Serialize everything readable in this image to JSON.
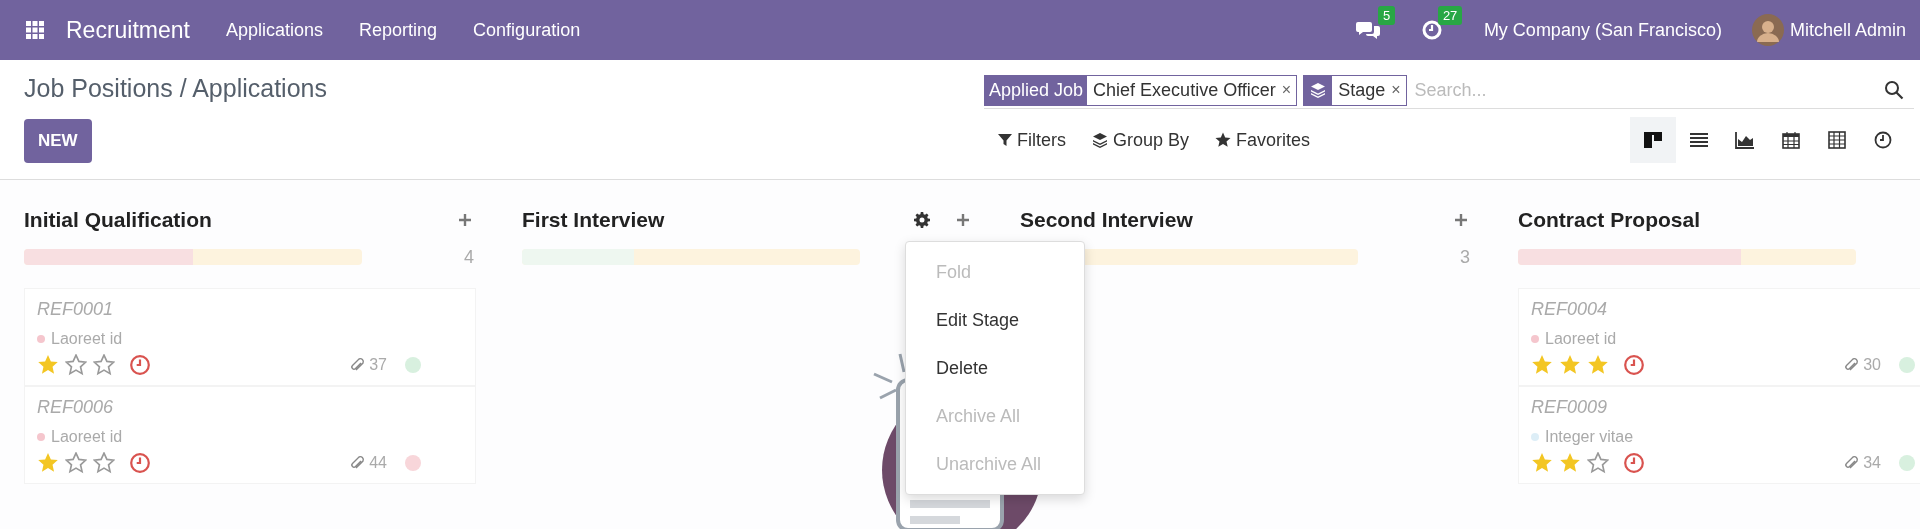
{
  "navbar": {
    "app_name": "Recruitment",
    "menu": [
      "Applications",
      "Reporting",
      "Configuration"
    ],
    "messages_count": "5",
    "activities_count": "27",
    "company": "My Company (San Francisco)",
    "user": "Mitchell Admin"
  },
  "breadcrumb": "Job Positions / Applications",
  "new_button": "NEW",
  "search": {
    "facets": [
      {
        "kind": "filter",
        "label": "Applied Job",
        "value": "Chief Executive Officer",
        "remove": "×"
      },
      {
        "kind": "group_by",
        "value": "Stage",
        "remove": "×"
      }
    ],
    "placeholder": "Search..."
  },
  "search_options": [
    {
      "kind": "filter",
      "label": "Filters"
    },
    {
      "kind": "group_by",
      "label": "Group By"
    },
    {
      "kind": "favorite",
      "label": "Favorites"
    }
  ],
  "views": [
    {
      "kind": "kanban",
      "selected": true
    },
    {
      "kind": "list",
      "selected": false
    },
    {
      "kind": "graph",
      "selected": false
    },
    {
      "kind": "calendar",
      "selected": false
    },
    {
      "kind": "pivot",
      "selected": false
    },
    {
      "kind": "activity",
      "selected": false
    }
  ],
  "columns": [
    {
      "title": "Initial Qualification",
      "quick_create": true,
      "count": "4",
      "progress": {
        "level": 0.5,
        "color": "#f8dfe1"
      },
      "cards": [
        {
          "ref": "REF0001",
          "tag": {
            "label": "Laoreet id",
            "color": "#f5c6cd"
          },
          "stars": 1,
          "attachments": "37",
          "status": {
            "color": "#d8f0df"
          }
        },
        {
          "ref": "REF0006",
          "tag": {
            "label": "Laoreet id",
            "color": "#f5c6cd"
          },
          "stars": 1,
          "attachments": "44",
          "status": {
            "color": "#f8d6da"
          }
        }
      ]
    },
    {
      "title": "First Interview",
      "settings": true,
      "quick_create": true,
      "progress": {
        "level": 0.33,
        "color": "#eef7f0"
      }
    },
    {
      "title": "Second Interview",
      "quick_create": true,
      "count": "3"
    },
    {
      "title": "Contract Proposal",
      "progress": {
        "level": 0.66,
        "color": "#f8dfe1"
      },
      "cards": [
        {
          "ref": "REF0004",
          "tag": {
            "label": "Laoreet id",
            "color": "#f5c6cd"
          },
          "stars": 3,
          "attachments": "30",
          "status": {
            "color": "#d8f0df"
          }
        },
        {
          "ref": "REF0009",
          "tag": {
            "label": "Integer vitae",
            "color": "#ddeef7"
          },
          "stars": 2,
          "attachments": "34",
          "status": {
            "color": "#d8f0df"
          }
        }
      ]
    }
  ],
  "stage_menu": [
    {
      "label": "Fold",
      "disabled": true
    },
    {
      "label": "Edit Stage",
      "disabled": false
    },
    {
      "label": "Delete",
      "disabled": false
    },
    {
      "label": "Archive All",
      "disabled": true
    },
    {
      "label": "Unarchive All",
      "disabled": true
    }
  ]
}
